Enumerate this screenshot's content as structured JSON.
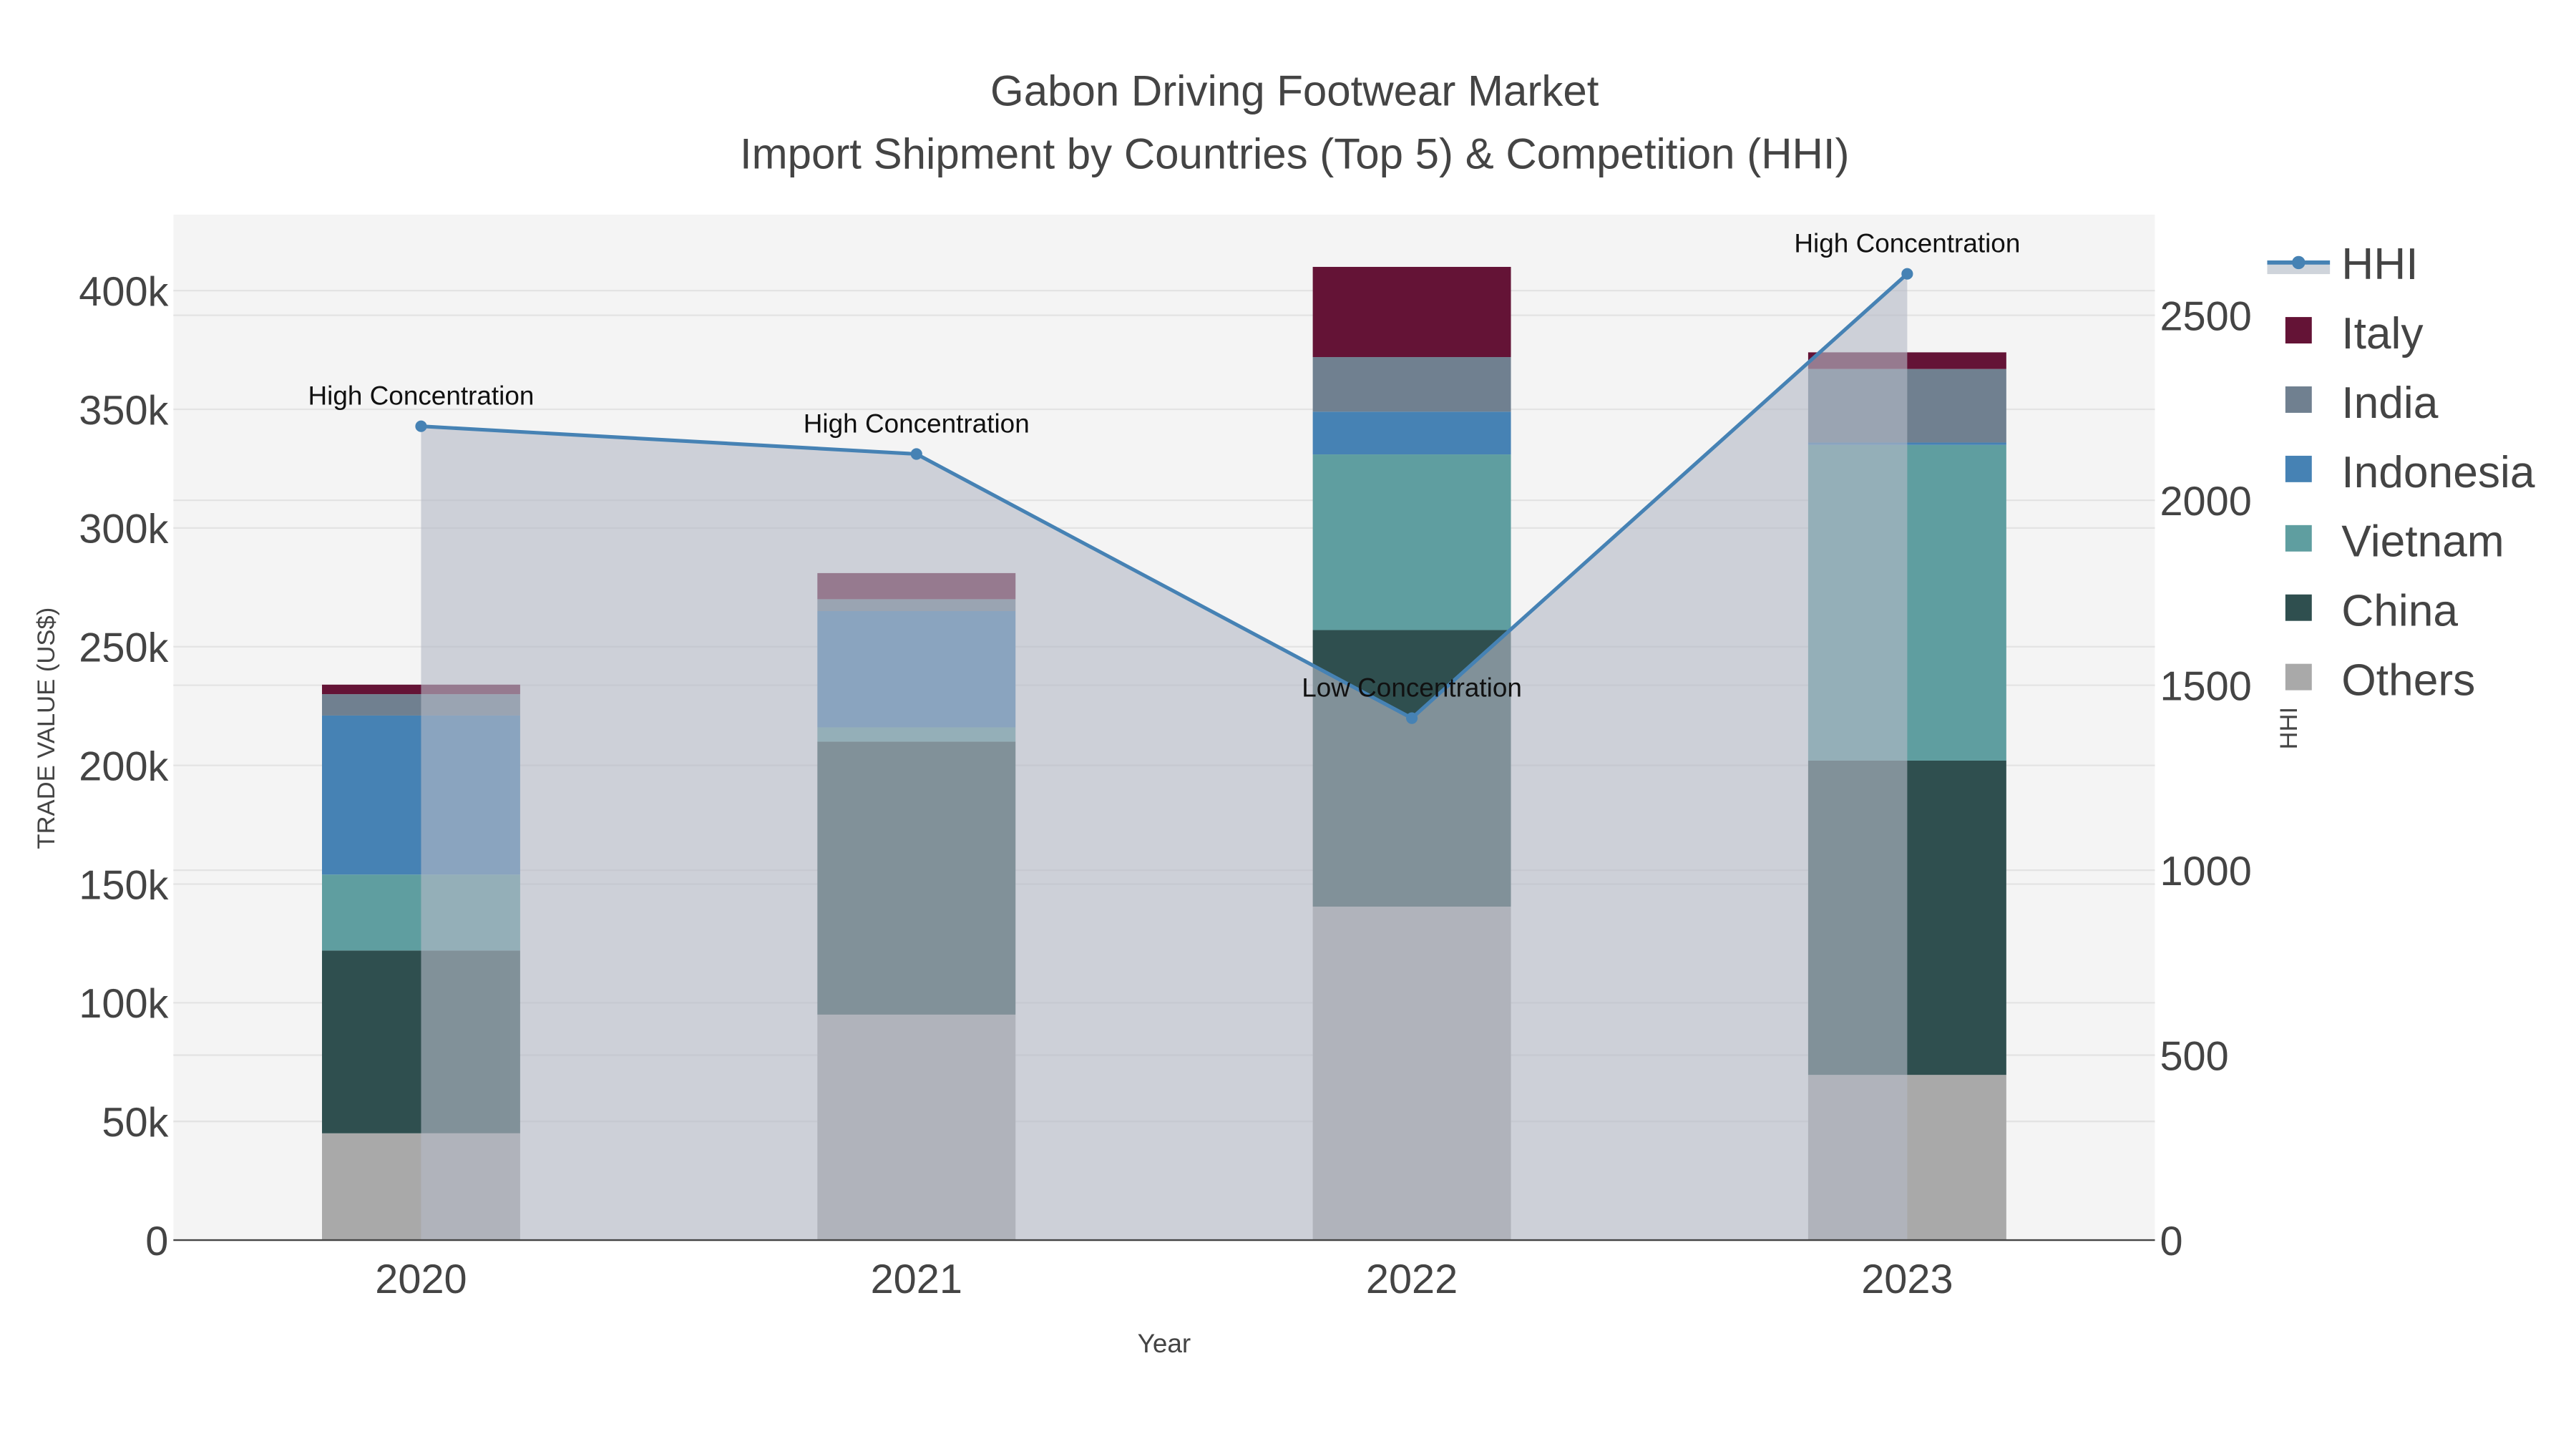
{
  "chart_data": {
    "type": "bar",
    "title": "Gabon Driving Footwear Market",
    "subtitle": "Import Shipment by Countries (Top 5) & Competition (HHI)",
    "xlabel": "Year",
    "ylabel": "TRADE VALUE (US$)",
    "y2label": "HHI",
    "categories": [
      "2020",
      "2021",
      "2022",
      "2023"
    ],
    "ylim": [
      0,
      432000
    ],
    "y2lim": [
      0,
      2772
    ],
    "yticks": [
      0,
      50000,
      100000,
      150000,
      200000,
      250000,
      300000,
      350000,
      400000
    ],
    "ytick_labels": [
      "0",
      "50k",
      "100k",
      "150k",
      "200k",
      "250k",
      "300k",
      "350k",
      "400k"
    ],
    "y2ticks": [
      0,
      500,
      1000,
      1500,
      2000,
      2500
    ],
    "y2tick_labels": [
      "0",
      "500",
      "1000",
      "1500",
      "2000",
      "2500"
    ],
    "barmode": "stack",
    "grid": true,
    "legend_placement": "right",
    "series": [
      {
        "name": "Others",
        "color": "#a9a9a9",
        "values": [
          45000,
          95000,
          140500,
          69600
        ]
      },
      {
        "name": "China",
        "color": "#2f4f4f",
        "values": [
          77000,
          115000,
          116500,
          132400
        ]
      },
      {
        "name": "Vietnam",
        "color": "#5f9ea0",
        "values": [
          32000,
          6000,
          74000,
          133000
        ]
      },
      {
        "name": "Indonesia",
        "color": "#4682b4",
        "values": [
          67000,
          49000,
          18000,
          1000
        ]
      },
      {
        "name": "India",
        "color": "#708090",
        "values": [
          9000,
          5000,
          23000,
          31000
        ]
      },
      {
        "name": "Italy",
        "color": "#641336",
        "values": [
          4000,
          11000,
          38000,
          7000
        ]
      }
    ],
    "line": {
      "name": "HHI",
      "color": "#4682b4",
      "values": [
        2200,
        2125,
        1411,
        2612
      ],
      "annotations": [
        "High Concentration",
        "High Concentration",
        "Low Concentration",
        "High Concentration"
      ]
    },
    "legend_order": [
      "HHI",
      "Italy",
      "India",
      "Indonesia",
      "Vietnam",
      "China",
      "Others"
    ]
  }
}
